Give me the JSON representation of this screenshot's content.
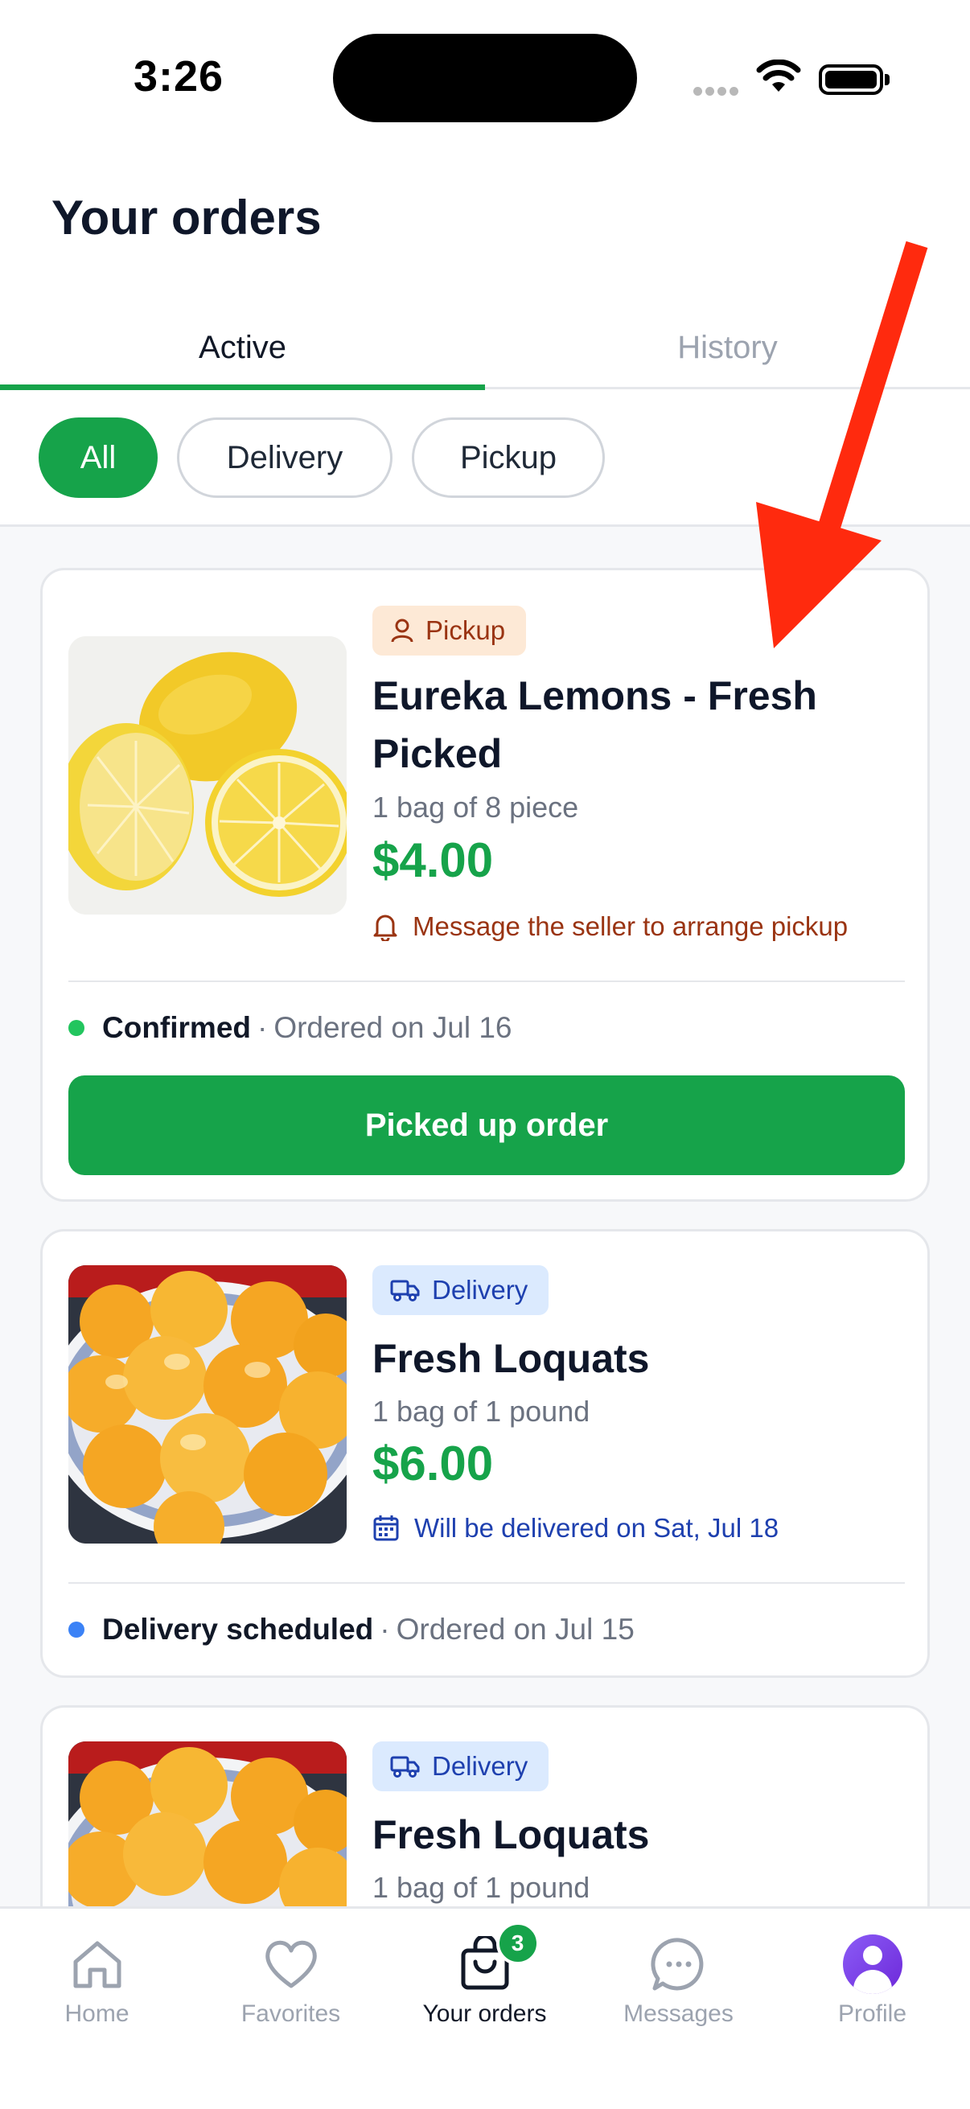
{
  "status_bar": {
    "time": "3:26"
  },
  "page": {
    "title": "Your orders"
  },
  "tabs": {
    "active": "Active",
    "history": "History"
  },
  "filters": {
    "all": "All",
    "delivery": "Delivery",
    "pickup": "Pickup"
  },
  "orders": [
    {
      "badge": "Pickup",
      "name": "Eureka Lemons - Fresh Picked",
      "quantity": "1 bag of 8 piece",
      "price": "$4.00",
      "note": "Message the seller to arrange pickup",
      "status": "Confirmed",
      "ordered": "Ordered on Jul 16",
      "button": "Picked up order",
      "status_color": "#22c55e"
    },
    {
      "badge": "Delivery",
      "name": "Fresh Loquats",
      "quantity": "1 bag of 1 pound",
      "price": "$6.00",
      "note": "Will be delivered on Sat, Jul 18",
      "status": "Delivery scheduled",
      "ordered": "Ordered on Jul 15",
      "status_color": "#3b82f6"
    },
    {
      "badge": "Delivery",
      "name": "Fresh Loquats",
      "quantity": "1 bag of 1 pound"
    }
  ],
  "tab_bar": {
    "home": "Home",
    "favorites": "Favorites",
    "orders": "Your orders",
    "orders_count": "3",
    "messages": "Messages",
    "profile": "Profile"
  },
  "colors": {
    "accent": "#16a34a",
    "annotation_arrow": "#ff2a0e"
  }
}
